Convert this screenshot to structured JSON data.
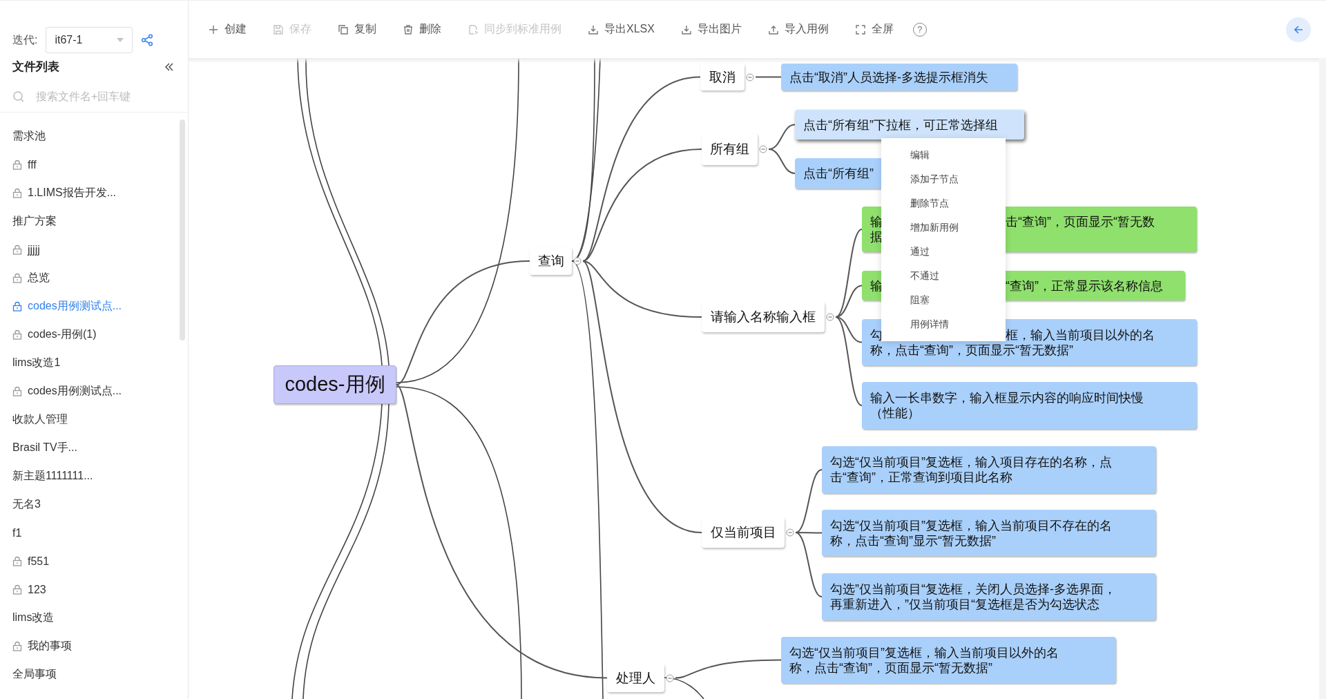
{
  "sidebar": {
    "iteration_label": "迭代:",
    "iteration_value": "it67-1",
    "title": "文件列表",
    "search": {
      "placeholder": "搜索文件名+回车键"
    },
    "items": [
      {
        "label": "需求池",
        "locked": false,
        "selected": false
      },
      {
        "label": "fff",
        "locked": true,
        "selected": false
      },
      {
        "label": "1.LIMS报告开发...",
        "locked": true,
        "selected": false
      },
      {
        "label": "推广方案",
        "locked": false,
        "selected": false
      },
      {
        "label": "jjjjj",
        "locked": true,
        "selected": false
      },
      {
        "label": "总览",
        "locked": true,
        "selected": false
      },
      {
        "label": "codes用例测试点...",
        "locked": true,
        "selected": true
      },
      {
        "label": "codes-用例(1)",
        "locked": true,
        "selected": false
      },
      {
        "label": "lims改造1",
        "locked": false,
        "selected": false
      },
      {
        "label": "codes用例测试点...",
        "locked": true,
        "selected": false
      },
      {
        "label": "收款人管理",
        "locked": false,
        "selected": false
      },
      {
        "label": "Brasil TV手...",
        "locked": false,
        "selected": false
      },
      {
        "label": "新主题1111111...",
        "locked": false,
        "selected": false
      },
      {
        "label": "无名3",
        "locked": false,
        "selected": false
      },
      {
        "label": "f1",
        "locked": false,
        "selected": false
      },
      {
        "label": "f551",
        "locked": true,
        "selected": false
      },
      {
        "label": "123",
        "locked": true,
        "selected": false
      },
      {
        "label": "lims改造",
        "locked": false,
        "selected": false
      },
      {
        "label": "我的事项",
        "locked": true,
        "selected": false
      },
      {
        "label": "全局事项",
        "locked": false,
        "selected": false
      }
    ]
  },
  "toolbar": {
    "items": [
      {
        "label": "创建",
        "kind": "plus",
        "disabled": false
      },
      {
        "label": "保存",
        "kind": "save",
        "disabled": true
      },
      {
        "label": "复制",
        "kind": "copy",
        "disabled": false
      },
      {
        "label": "删除",
        "kind": "delete",
        "disabled": false
      },
      {
        "label": "同步到标准用例",
        "kind": "sync",
        "disabled": true
      },
      {
        "label": "导出XLSX",
        "kind": "export",
        "disabled": false
      },
      {
        "label": "导出图片",
        "kind": "export",
        "disabled": false
      },
      {
        "label": "导入用例",
        "kind": "import",
        "disabled": false
      },
      {
        "label": "全屏",
        "kind": "fullscreen",
        "disabled": false
      }
    ],
    "help": "?"
  },
  "mindmap": {
    "root": {
      "label": "codes-用例",
      "children": [
        {
          "label": "查询",
          "expanded": true,
          "children": [
            {
              "label": "取消",
              "expanded": true,
              "children": [
                {
                  "lines": [
                    "点击“取消”人员选择-多选提示框消失"
                  ],
                  "color": "#a9d0fb",
                  "selected": false
                }
              ]
            },
            {
              "label": "所有组",
              "expanded": true,
              "children": [
                {
                  "lines": [
                    "点击“所有组”下拉框，可正常选择组"
                  ],
                  "color": "#cfe4fc",
                  "selected": true
                },
                {
                  "lines": [
                    "点击“所有组”"
                  ],
                  "color": "#a9d0fb",
                  "selected": false
                }
              ]
            },
            {
              "label": "请输入名称输入框",
              "expanded": true,
              "children": [
                {
                  "lines": [
                    "输",
                    "据"
                  ],
                  "lines_after_menu": [
                    "击“查询”，页面显示“暂无数"
                  ],
                  "color": "#8fe06d",
                  "selected": false
                },
                {
                  "lines": [
                    "输"
                  ],
                  "lines_after_menu": [
                    "“查询”，正常显示该名称信息"
                  ],
                  "color": "#8fe06d",
                  "selected": false
                },
                {
                  "lines": [
                    "勾",
                    "称，点击“查询”，页面显示“暂无数据”"
                  ],
                  "lines_after_menu": [
                    "框，输入当前项目以外的名"
                  ],
                  "color": "#a9d0fb",
                  "selected": false
                },
                {
                  "lines": [
                    "输入一长串数字，输入框显示内容的响应时间快慢",
                    "（性能）"
                  ],
                  "color": "#a9d0fb",
                  "selected": false
                }
              ]
            },
            {
              "label": "仅当前项目",
              "expanded": true,
              "children": [
                {
                  "lines": [
                    "勾选“仅当前项目”复选框，输入项目存在的名称，点",
                    "击“查询”，正常查询到项目此名称"
                  ],
                  "color": "#a9d0fb",
                  "selected": false
                },
                {
                  "lines": [
                    "勾选“仅当前项目”复选框，输入当前项目不存在的名",
                    "称，点击“查询”显示“暂无数据”"
                  ],
                  "color": "#a9d0fb",
                  "selected": false
                },
                {
                  "lines": [
                    "勾选”仅当前项目“复选框，关闭人员选择-多选界面，",
                    "再重新进入，”仅当前项目“复选框是否为勾选状态"
                  ],
                  "color": "#a9d0fb",
                  "selected": false
                }
              ]
            }
          ]
        },
        {
          "label": "处理人",
          "expanded": true,
          "children": [
            {
              "lines": [
                "勾选“仅当前项目”复选框，输入当前项目以外的名",
                "称，点击“查询”，页面显示“暂无数据”"
              ],
              "color": "#a9d0fb",
              "selected": false
            }
          ]
        }
      ]
    }
  },
  "context_menu": {
    "items": [
      "编辑",
      "添加子节点",
      "删除节点",
      "增加新用例",
      "通过",
      "不通过",
      "阻塞",
      "用例详情"
    ]
  }
}
